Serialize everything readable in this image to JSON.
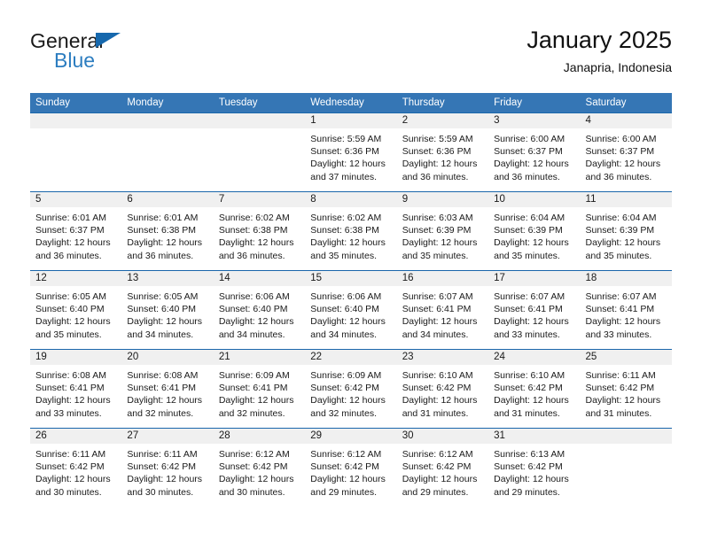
{
  "logo": {
    "word1": "General",
    "word2": "Blue",
    "triangle_color": "#1668ad",
    "blue_color": "#2c7dc0"
  },
  "header": {
    "title": "January 2025",
    "subtitle": "Janapria, Indonesia"
  },
  "theme": {
    "header_blue": "#3576b5",
    "row_rule_blue": "#1a66ab",
    "daynum_band": "#f0f0f0"
  },
  "labels": {
    "sunrise_prefix": "Sunrise:",
    "sunset_prefix": "Sunset:",
    "daylight_prefix": "Daylight:"
  },
  "weekdays": [
    "Sunday",
    "Monday",
    "Tuesday",
    "Wednesday",
    "Thursday",
    "Friday",
    "Saturday"
  ],
  "weeks": [
    [
      {
        "day": "",
        "empty": true
      },
      {
        "day": "",
        "empty": true
      },
      {
        "day": "",
        "empty": true
      },
      {
        "day": "1",
        "sunrise": "Sunrise: 5:59 AM",
        "sunset": "Sunset: 6:36 PM",
        "daylight1": "Daylight: 12 hours",
        "daylight2": "and 37 minutes."
      },
      {
        "day": "2",
        "sunrise": "Sunrise: 5:59 AM",
        "sunset": "Sunset: 6:36 PM",
        "daylight1": "Daylight: 12 hours",
        "daylight2": "and 36 minutes."
      },
      {
        "day": "3",
        "sunrise": "Sunrise: 6:00 AM",
        "sunset": "Sunset: 6:37 PM",
        "daylight1": "Daylight: 12 hours",
        "daylight2": "and 36 minutes."
      },
      {
        "day": "4",
        "sunrise": "Sunrise: 6:00 AM",
        "sunset": "Sunset: 6:37 PM",
        "daylight1": "Daylight: 12 hours",
        "daylight2": "and 36 minutes."
      }
    ],
    [
      {
        "day": "5",
        "sunrise": "Sunrise: 6:01 AM",
        "sunset": "Sunset: 6:37 PM",
        "daylight1": "Daylight: 12 hours",
        "daylight2": "and 36 minutes."
      },
      {
        "day": "6",
        "sunrise": "Sunrise: 6:01 AM",
        "sunset": "Sunset: 6:38 PM",
        "daylight1": "Daylight: 12 hours",
        "daylight2": "and 36 minutes."
      },
      {
        "day": "7",
        "sunrise": "Sunrise: 6:02 AM",
        "sunset": "Sunset: 6:38 PM",
        "daylight1": "Daylight: 12 hours",
        "daylight2": "and 36 minutes."
      },
      {
        "day": "8",
        "sunrise": "Sunrise: 6:02 AM",
        "sunset": "Sunset: 6:38 PM",
        "daylight1": "Daylight: 12 hours",
        "daylight2": "and 35 minutes."
      },
      {
        "day": "9",
        "sunrise": "Sunrise: 6:03 AM",
        "sunset": "Sunset: 6:39 PM",
        "daylight1": "Daylight: 12 hours",
        "daylight2": "and 35 minutes."
      },
      {
        "day": "10",
        "sunrise": "Sunrise: 6:04 AM",
        "sunset": "Sunset: 6:39 PM",
        "daylight1": "Daylight: 12 hours",
        "daylight2": "and 35 minutes."
      },
      {
        "day": "11",
        "sunrise": "Sunrise: 6:04 AM",
        "sunset": "Sunset: 6:39 PM",
        "daylight1": "Daylight: 12 hours",
        "daylight2": "and 35 minutes."
      }
    ],
    [
      {
        "day": "12",
        "sunrise": "Sunrise: 6:05 AM",
        "sunset": "Sunset: 6:40 PM",
        "daylight1": "Daylight: 12 hours",
        "daylight2": "and 35 minutes."
      },
      {
        "day": "13",
        "sunrise": "Sunrise: 6:05 AM",
        "sunset": "Sunset: 6:40 PM",
        "daylight1": "Daylight: 12 hours",
        "daylight2": "and 34 minutes."
      },
      {
        "day": "14",
        "sunrise": "Sunrise: 6:06 AM",
        "sunset": "Sunset: 6:40 PM",
        "daylight1": "Daylight: 12 hours",
        "daylight2": "and 34 minutes."
      },
      {
        "day": "15",
        "sunrise": "Sunrise: 6:06 AM",
        "sunset": "Sunset: 6:40 PM",
        "daylight1": "Daylight: 12 hours",
        "daylight2": "and 34 minutes."
      },
      {
        "day": "16",
        "sunrise": "Sunrise: 6:07 AM",
        "sunset": "Sunset: 6:41 PM",
        "daylight1": "Daylight: 12 hours",
        "daylight2": "and 34 minutes."
      },
      {
        "day": "17",
        "sunrise": "Sunrise: 6:07 AM",
        "sunset": "Sunset: 6:41 PM",
        "daylight1": "Daylight: 12 hours",
        "daylight2": "and 33 minutes."
      },
      {
        "day": "18",
        "sunrise": "Sunrise: 6:07 AM",
        "sunset": "Sunset: 6:41 PM",
        "daylight1": "Daylight: 12 hours",
        "daylight2": "and 33 minutes."
      }
    ],
    [
      {
        "day": "19",
        "sunrise": "Sunrise: 6:08 AM",
        "sunset": "Sunset: 6:41 PM",
        "daylight1": "Daylight: 12 hours",
        "daylight2": "and 33 minutes."
      },
      {
        "day": "20",
        "sunrise": "Sunrise: 6:08 AM",
        "sunset": "Sunset: 6:41 PM",
        "daylight1": "Daylight: 12 hours",
        "daylight2": "and 32 minutes."
      },
      {
        "day": "21",
        "sunrise": "Sunrise: 6:09 AM",
        "sunset": "Sunset: 6:41 PM",
        "daylight1": "Daylight: 12 hours",
        "daylight2": "and 32 minutes."
      },
      {
        "day": "22",
        "sunrise": "Sunrise: 6:09 AM",
        "sunset": "Sunset: 6:42 PM",
        "daylight1": "Daylight: 12 hours",
        "daylight2": "and 32 minutes."
      },
      {
        "day": "23",
        "sunrise": "Sunrise: 6:10 AM",
        "sunset": "Sunset: 6:42 PM",
        "daylight1": "Daylight: 12 hours",
        "daylight2": "and 31 minutes."
      },
      {
        "day": "24",
        "sunrise": "Sunrise: 6:10 AM",
        "sunset": "Sunset: 6:42 PM",
        "daylight1": "Daylight: 12 hours",
        "daylight2": "and 31 minutes."
      },
      {
        "day": "25",
        "sunrise": "Sunrise: 6:11 AM",
        "sunset": "Sunset: 6:42 PM",
        "daylight1": "Daylight: 12 hours",
        "daylight2": "and 31 minutes."
      }
    ],
    [
      {
        "day": "26",
        "sunrise": "Sunrise: 6:11 AM",
        "sunset": "Sunset: 6:42 PM",
        "daylight1": "Daylight: 12 hours",
        "daylight2": "and 30 minutes."
      },
      {
        "day": "27",
        "sunrise": "Sunrise: 6:11 AM",
        "sunset": "Sunset: 6:42 PM",
        "daylight1": "Daylight: 12 hours",
        "daylight2": "and 30 minutes."
      },
      {
        "day": "28",
        "sunrise": "Sunrise: 6:12 AM",
        "sunset": "Sunset: 6:42 PM",
        "daylight1": "Daylight: 12 hours",
        "daylight2": "and 30 minutes."
      },
      {
        "day": "29",
        "sunrise": "Sunrise: 6:12 AM",
        "sunset": "Sunset: 6:42 PM",
        "daylight1": "Daylight: 12 hours",
        "daylight2": "and 29 minutes."
      },
      {
        "day": "30",
        "sunrise": "Sunrise: 6:12 AM",
        "sunset": "Sunset: 6:42 PM",
        "daylight1": "Daylight: 12 hours",
        "daylight2": "and 29 minutes."
      },
      {
        "day": "31",
        "sunrise": "Sunrise: 6:13 AM",
        "sunset": "Sunset: 6:42 PM",
        "daylight1": "Daylight: 12 hours",
        "daylight2": "and 29 minutes."
      },
      {
        "day": "",
        "empty": true
      }
    ]
  ]
}
